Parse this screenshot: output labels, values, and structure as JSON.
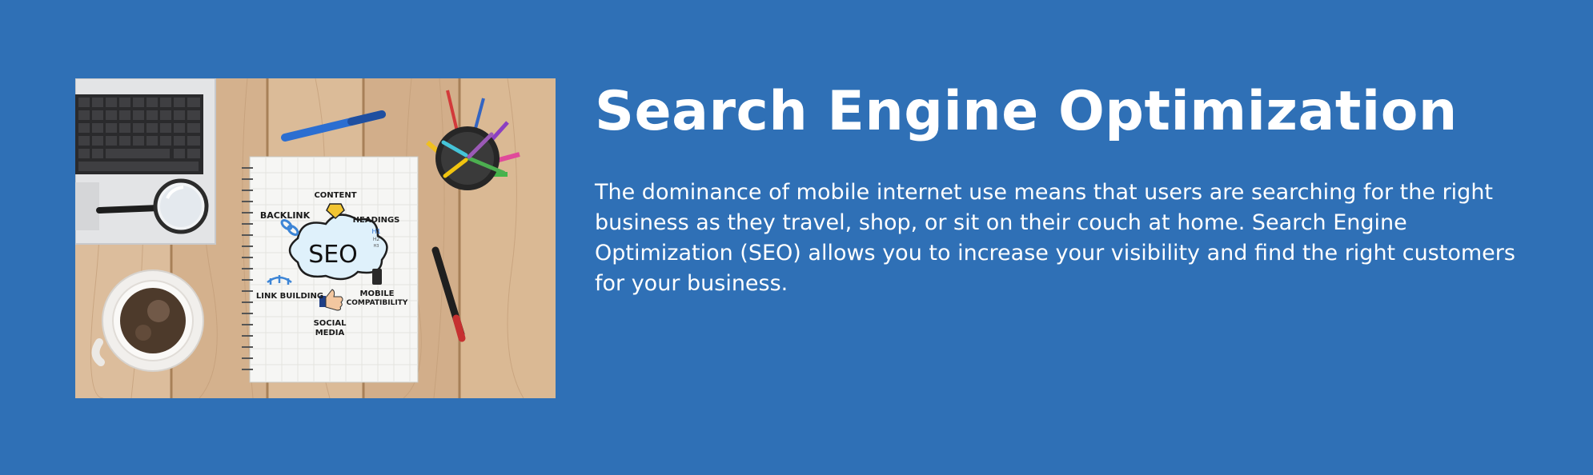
{
  "section": {
    "title": "Search Engine Optimization",
    "description": "The dominance of mobile internet use means that users are searching for the right business as they travel, shop, or sit on their couch at home. Search Engine Optimization (SEO) allows you to increase your visibility and find the right customers for your business."
  },
  "image": {
    "notebook": {
      "center_label": "SEO",
      "content_label": "CONTENT",
      "backlink_label": "BACKLINK",
      "headings_label": "HEADINGS",
      "headings_h1": "H1",
      "headings_h2": "H2",
      "headings_h3": "H3",
      "link_building_label": "LINK BUILDING",
      "mobile_label_1": "MOBILE",
      "mobile_label_2": "COMPATIBILITY",
      "social_label_1": "SOCIAL",
      "social_label_2": "MEDIA"
    }
  },
  "colors": {
    "background": "#2f70b6",
    "text": "#ffffff",
    "wood": "#d7b593"
  }
}
